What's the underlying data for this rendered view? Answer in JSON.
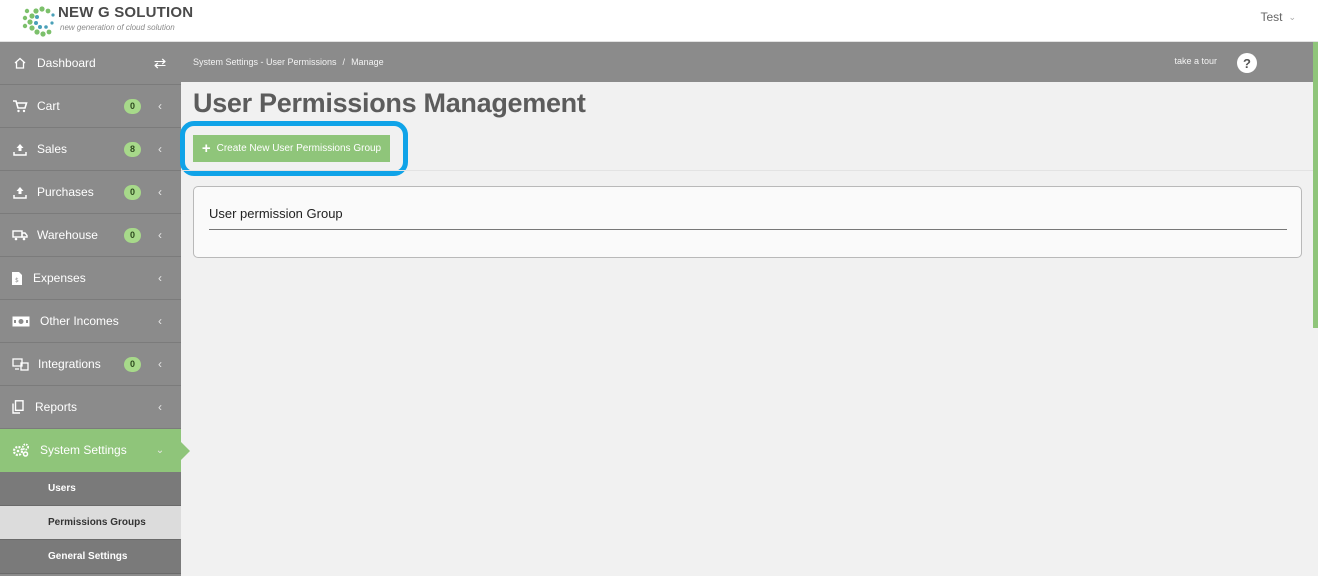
{
  "header": {
    "brand": "NEW G SOLUTION",
    "tagline": "new generation of cloud solution",
    "user_name": "Test"
  },
  "sidebar": {
    "items": [
      {
        "label": "Dashboard",
        "icon": "home-icon"
      },
      {
        "label": "Cart",
        "badge": "0",
        "icon": "cart-icon"
      },
      {
        "label": "Sales",
        "badge": "8",
        "icon": "upload-icon"
      },
      {
        "label": "Purchases",
        "badge": "0",
        "icon": "upload-icon"
      },
      {
        "label": "Warehouse",
        "badge": "0",
        "icon": "truck-icon"
      },
      {
        "label": "Expenses",
        "icon": "document-icon"
      },
      {
        "label": "Other Incomes",
        "icon": "money-icon"
      },
      {
        "label": "Integrations",
        "badge": "0",
        "icon": "integration-icon"
      },
      {
        "label": "Reports",
        "icon": "copy-icon"
      },
      {
        "label": "System Settings",
        "icon": "gears-icon",
        "active": true
      }
    ],
    "subitems": [
      {
        "label": "Users"
      },
      {
        "label": "Permissions Groups",
        "active": true
      },
      {
        "label": "General Settings"
      }
    ]
  },
  "breadcrumb": {
    "parent": "System Settings - User Permissions",
    "separator": "/",
    "current": "Manage"
  },
  "tour_label": "take a tour",
  "help_label": "?",
  "main": {
    "title": "User Permissions Management",
    "create_button": "Create New User Permissions Group",
    "panel_title": "User permission Group"
  },
  "colors": {
    "accent": "#8fc57a",
    "sidebar": "#8b8b8b",
    "highlight": "#10a3e8"
  }
}
